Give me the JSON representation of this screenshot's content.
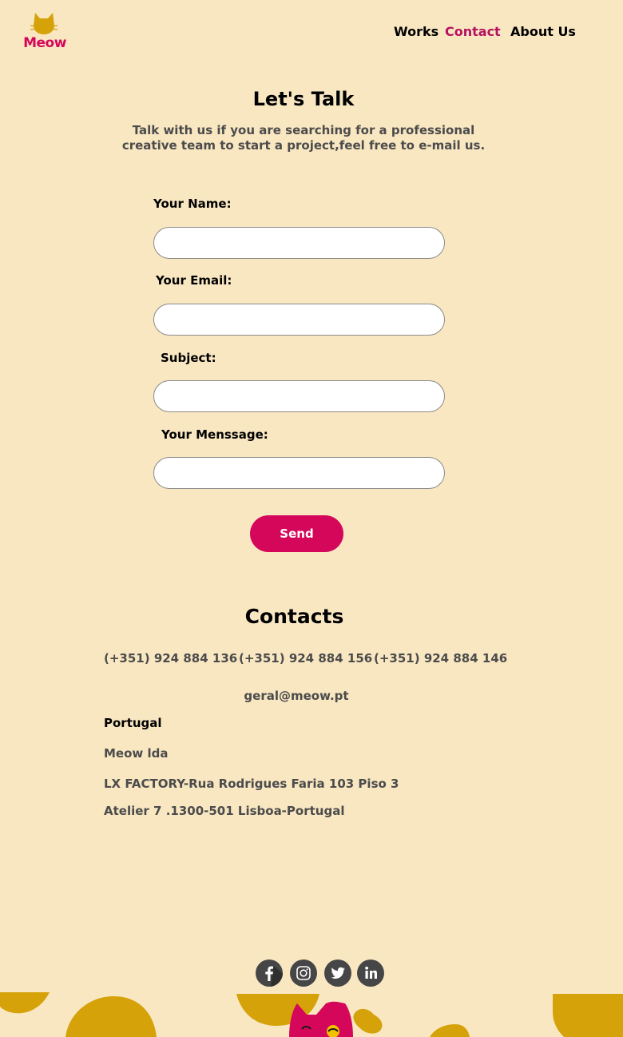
{
  "brand": {
    "name": "Meow",
    "logo_color": "#d5075a",
    "cat_color": "#d5a20a"
  },
  "nav": {
    "items": [
      {
        "label": "Works",
        "active": false
      },
      {
        "label": "Contact",
        "active": true
      },
      {
        "label": "About Us",
        "active": false
      }
    ]
  },
  "hero": {
    "title": "Let's Talk",
    "intro": "Talk with us if you are searching for a professional creative team to start a project,feel free to e-mail us."
  },
  "form": {
    "name_label": "Your Name:",
    "name_value": "",
    "email_label": "Your Email:",
    "email_value": "",
    "subject_label": "Subject:",
    "subject_value": "",
    "message_label": "Your Menssage:",
    "message_value": "",
    "send_label": "Send"
  },
  "contacts": {
    "title": "Contacts",
    "phones": [
      "(+351) 924 884 136",
      "(+351) 924 884 156",
      "(+351) 924 884 146"
    ],
    "email": "geral@meow.pt",
    "country": "Portugal",
    "company": "Meow lda",
    "address_line1": "LX FACTORY-Rua Rodrigues Faria 103 Piso 3",
    "address_line2": "Atelier 7 .1300-501 Lisboa-Portugal"
  },
  "social": {
    "icons": [
      "facebook-icon",
      "instagram-icon",
      "twitter-icon",
      "linkedin-icon"
    ]
  },
  "colors": {
    "background": "#f9e7c2",
    "accent": "#d5075a",
    "mustard": "#d5a20a",
    "text_gray": "#4b4b4b"
  }
}
